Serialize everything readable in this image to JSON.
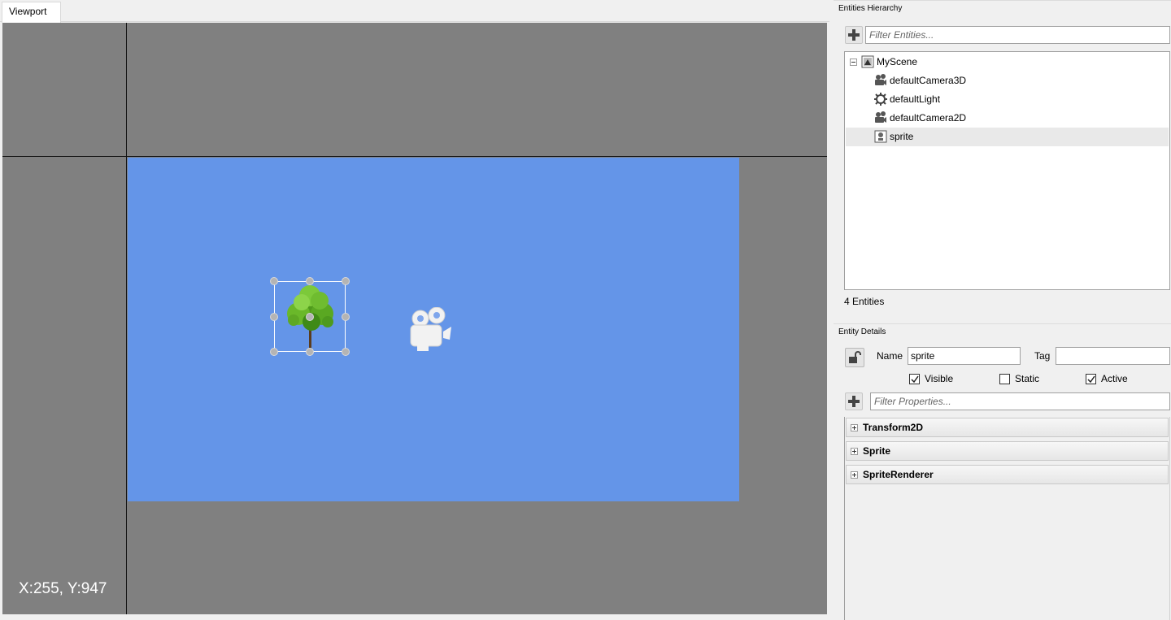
{
  "viewport": {
    "tab_label": "Viewport",
    "coords_text": "X:255, Y:947",
    "colors": {
      "background": "#808080",
      "game_area": "#6495e8",
      "axis": "#111111"
    }
  },
  "hierarchy": {
    "title": "Entities Hierarchy",
    "filter_placeholder": "Filter Entities...",
    "root_label": "MyScene",
    "items": [
      {
        "label": "defaultCamera3D",
        "icon": "camera-icon"
      },
      {
        "label": "defaultLight",
        "icon": "light-gear-icon"
      },
      {
        "label": "defaultCamera2D",
        "icon": "camera-icon"
      },
      {
        "label": "sprite",
        "icon": "sprite-icon",
        "selected": true
      }
    ],
    "count_text": "4 Entities"
  },
  "details": {
    "title": "Entity Details",
    "name_label": "Name",
    "name_value": "sprite",
    "tag_label": "Tag",
    "tag_value": "",
    "checkboxes": [
      {
        "label": "Visible",
        "checked": true
      },
      {
        "label": "Static",
        "checked": false
      },
      {
        "label": "Active",
        "checked": true
      }
    ],
    "filter_placeholder": "Filter Properties...",
    "components": [
      "Transform2D",
      "Sprite",
      "SpriteRenderer"
    ]
  }
}
